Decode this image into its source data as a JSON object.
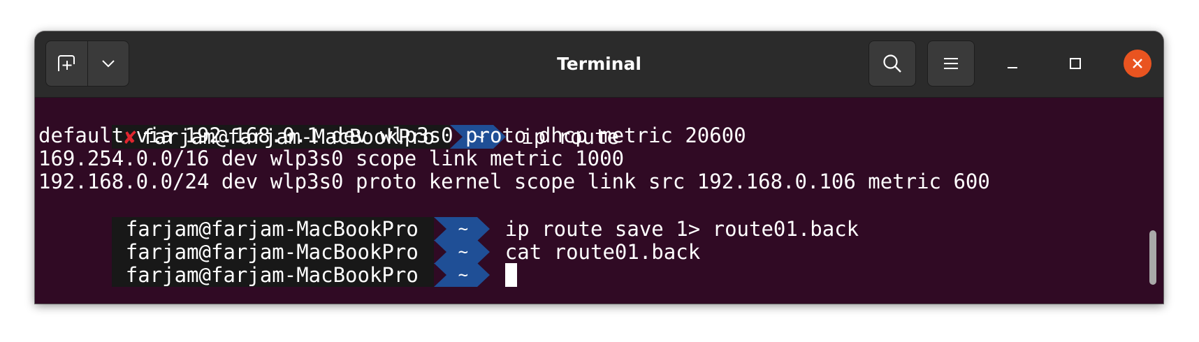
{
  "window": {
    "title": "Terminal"
  },
  "toolbar": {
    "new_tab_icon": "new-tab-icon",
    "dropdown_icon": "chevron-down-icon",
    "search_icon": "search-icon",
    "menu_icon": "hamburger-menu-icon",
    "minimize_icon": "minimize-icon",
    "maximize_icon": "maximize-icon",
    "close_icon": "close-icon"
  },
  "colors": {
    "terminal_bg": "#300a24",
    "titlebar_bg": "#2b2b2b",
    "close_accent": "#e95420",
    "prompt_context_bg": "#181818",
    "prompt_dir_bg": "#1f4f96",
    "error_mark": "#e0262f"
  },
  "terminal": {
    "lines": [
      {
        "status": "✘",
        "context": "farjam@farjam-MacBookPro",
        "dir": "~",
        "command": "ip route"
      },
      {
        "text": "default via 192.168.0.1 dev wlp3s0 proto dhcp metric 20600"
      },
      {
        "text": "169.254.0.0/16 dev wlp3s0 scope link metric 1000"
      },
      {
        "text": "192.168.0.0/24 dev wlp3s0 proto kernel scope link src 192.168.0.106 metric 600"
      },
      {
        "context": "farjam@farjam-MacBookPro",
        "dir": "~",
        "command": "ip route save 1> route01.back"
      },
      {
        "context": "farjam@farjam-MacBookPro",
        "dir": "~",
        "command": "cat route01.back"
      },
      {
        "context": "farjam@farjam-MacBookPro",
        "dir": "~",
        "command": ""
      }
    ]
  }
}
